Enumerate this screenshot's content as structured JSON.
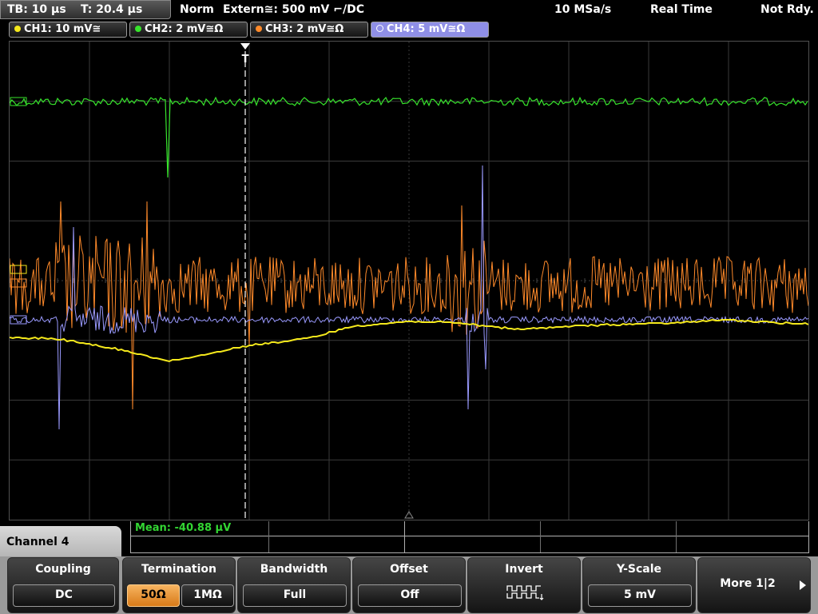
{
  "status_bar": {
    "timebase": "TB: 10 µs",
    "trigger_time": "T: 20.4 µs",
    "trigger_mode": "Norm",
    "trigger_source": "Extern≅: 500 mV ⌐/DC",
    "sample_rate": "10 MSa/s",
    "acq_mode": "Real Time",
    "status": "Not Rdy."
  },
  "channels": [
    {
      "label": "CH1: 10 mV≅",
      "color": "#f4e81c"
    },
    {
      "label": "CH2: 2 mV≅Ω",
      "color": "#37e42c"
    },
    {
      "label": "CH3: 2 mV≅Ω",
      "color": "#ff8a2a"
    },
    {
      "label": "CH4: 5 mV≅Ω",
      "color": "#9a9aff"
    }
  ],
  "active_channel_index": 3,
  "trigger_marker": "T",
  "measurement": "Mean: -40.88 µV",
  "menu_title": "Channel 4",
  "softkeys": {
    "coupling": {
      "title": "Coupling",
      "value": "DC"
    },
    "termination": {
      "title": "Termination",
      "options": [
        "50Ω",
        "1MΩ"
      ],
      "selected": "50Ω"
    },
    "bandwidth": {
      "title": "Bandwidth",
      "value": "Full"
    },
    "offset": {
      "title": "Offset",
      "value": "Off"
    },
    "invert": {
      "title": "Invert",
      "icon": "invert-waveform-icon"
    },
    "yscale": {
      "title": "Y-Scale",
      "value": "5 mV"
    },
    "more": {
      "label": "More 1|2",
      "icon": "play-right-icon"
    }
  }
}
